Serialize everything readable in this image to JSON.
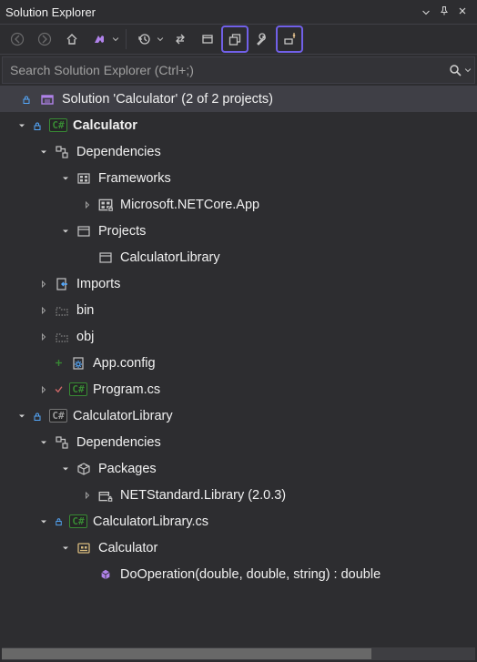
{
  "panel": {
    "title": "Solution Explorer"
  },
  "search": {
    "placeholder": "Search Solution Explorer (Ctrl+;)"
  },
  "tree": {
    "solution": "Solution 'Calculator' (2 of 2 projects)",
    "n0": "Calculator",
    "n1": "Dependencies",
    "n2": "Frameworks",
    "n3": "Microsoft.NETCore.App",
    "n4": "Projects",
    "n5": "CalculatorLibrary",
    "n6": "Imports",
    "n7": "bin",
    "n8": "obj",
    "n9": "App.config",
    "n10": "Program.cs",
    "n11": "CalculatorLibrary",
    "n12": "Dependencies",
    "n13": "Packages",
    "n14": "NETStandard.Library (2.0.3)",
    "n15": "CalculatorLibrary.cs",
    "n16": "Calculator",
    "n17": "DoOperation(double, double, string) : double"
  }
}
